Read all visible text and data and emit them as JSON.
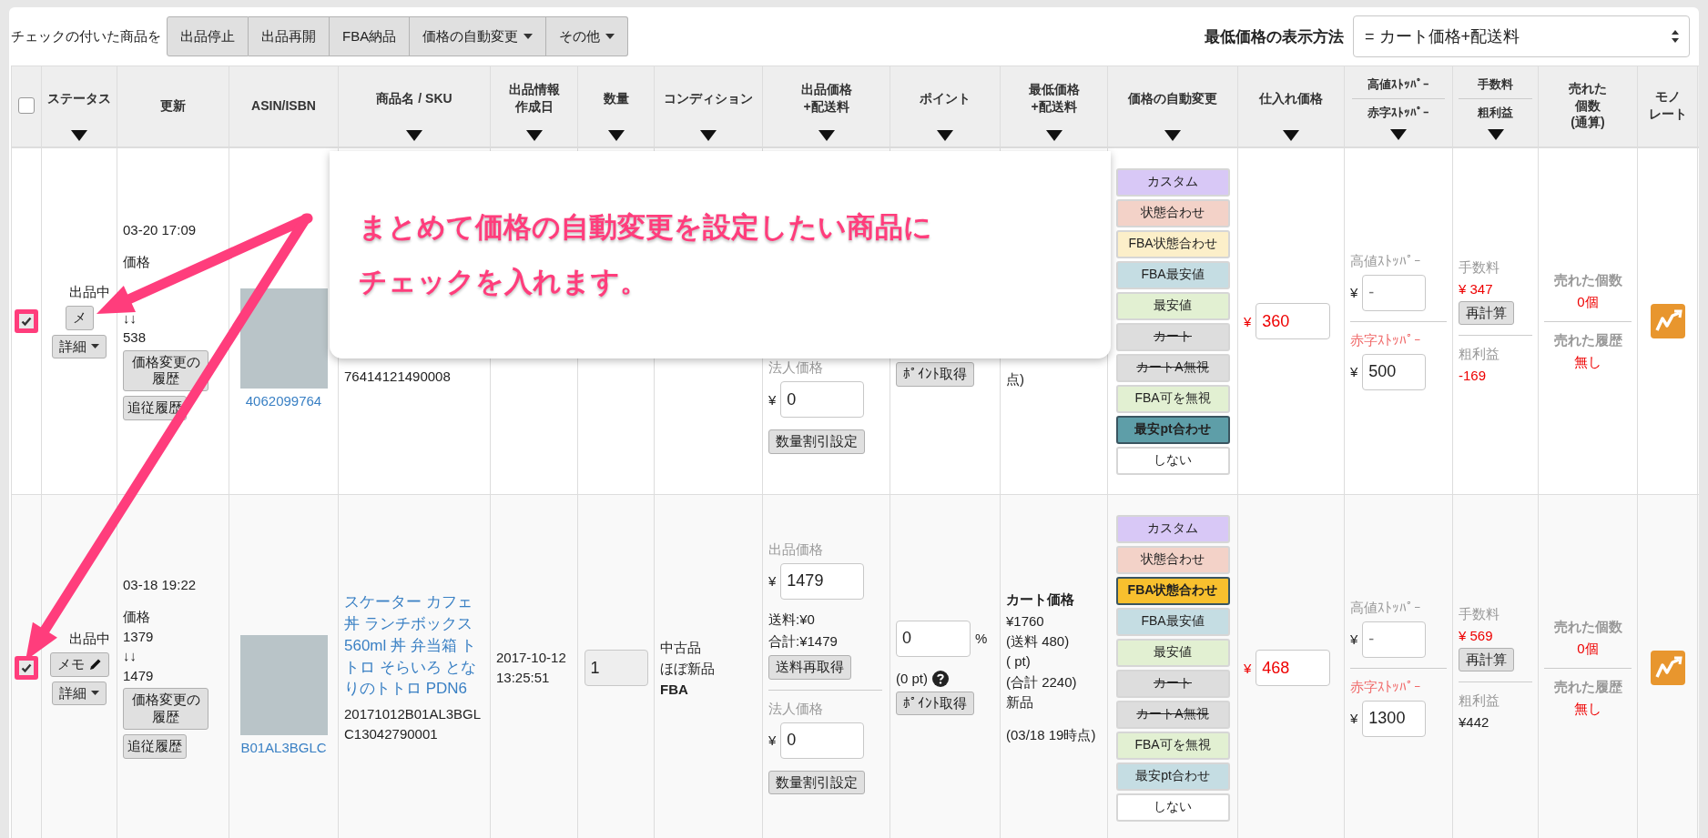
{
  "toolbar": {
    "label": "チェックの付いた商品を",
    "buttons": [
      {
        "label": "出品停止",
        "dropdown": false
      },
      {
        "label": "出品再開",
        "dropdown": false
      },
      {
        "label": "FBA納品",
        "dropdown": false
      },
      {
        "label": "価格の自動変更",
        "dropdown": true
      },
      {
        "label": "その他",
        "dropdown": true
      }
    ]
  },
  "display_method": {
    "label": "最低価格の表示方法",
    "value": "= カート価格+配送料"
  },
  "table": {
    "header_checkbox": {
      "checked": false
    },
    "columns": [
      {
        "lines": [
          "ステータス"
        ],
        "sortable": true
      },
      {
        "lines": [
          "更新"
        ],
        "sortable": false
      },
      {
        "lines": [
          "ASIN/ISBN"
        ],
        "sortable": false
      },
      {
        "lines": [
          "商品名 / SKU"
        ],
        "sortable": true
      },
      {
        "lines": [
          "出品情報",
          "作成日"
        ],
        "sortable": true
      },
      {
        "lines": [
          "数量"
        ],
        "sortable": true
      },
      {
        "lines": [
          "コンディション"
        ],
        "sortable": true
      },
      {
        "lines": [
          "出品価格",
          "+配送料"
        ],
        "sortable": true
      },
      {
        "lines": [
          "ポイント"
        ],
        "sortable": true
      },
      {
        "lines": [
          "最低価格",
          "+配送料"
        ],
        "sortable": true
      },
      {
        "lines": [
          "価格の自動変更"
        ],
        "sortable": true
      },
      {
        "lines": [
          "仕入れ価格"
        ],
        "sortable": true
      },
      {
        "lines": [
          "高値ｽﾄｯﾊﾟｰ"
        ],
        "second": "赤字ｽﾄｯﾊﾟｰ",
        "sortable": true
      },
      {
        "lines": [
          "手数料"
        ],
        "second": "粗利益",
        "sortable": true
      },
      {
        "lines": [
          "売れた",
          "個数",
          "(通算)"
        ],
        "sortable": false
      },
      {
        "lines": [
          "モノ",
          "レート"
        ],
        "sortable": false
      }
    ],
    "rows": [
      {
        "checked": true,
        "highlighted": true,
        "status": "出品中",
        "memo": {
          "label": "メ",
          "pencil": false
        },
        "detail": "詳細",
        "updated": "03-20 17:09",
        "price_history": [
          "価格",
          "↓↓",
          "538"
        ],
        "history_buttons": [
          "価格変更の履歴",
          "追従履歴"
        ],
        "asin": "4062099764",
        "sku": "76414121490008",
        "listing": {
          "corporate_label": "法人価格",
          "corporate_currency": "¥",
          "corporate_value": "0",
          "discount_button": "数量割引設定"
        },
        "points": {
          "button": "ﾎﾟｲﾝﾄ取得"
        },
        "lowest": {
          "lines": [
            "点)"
          ]
        },
        "auto_price": [
          {
            "label": "カスタム",
            "color": "#d8c8f6",
            "selected": false,
            "strike": false
          },
          {
            "label": "状態合わせ",
            "color": "#f3d2c8",
            "selected": false,
            "strike": false
          },
          {
            "label": "FBA状態合わせ",
            "color": "#fcefc9",
            "selected": false,
            "strike": false
          },
          {
            "label": "FBA最安値",
            "color": "#c5dde3",
            "selected": false,
            "strike": false
          },
          {
            "label": "最安値",
            "color": "#e2f0d2",
            "selected": false,
            "strike": false
          },
          {
            "label": "カート",
            "color": "#dddddd",
            "selected": false,
            "strike": true
          },
          {
            "label": "カートA無視",
            "color": "#dddddd",
            "selected": false,
            "strike": true
          },
          {
            "label": "FBA可を無視",
            "color": "#e2f0d2",
            "selected": false,
            "strike": false
          },
          {
            "label": "最安pt合わせ",
            "color": "#5e9ea8",
            "selected": true,
            "strike": false
          },
          {
            "label": "しない",
            "color": "#ffffff",
            "selected": false,
            "strike": false
          }
        ],
        "purchase": {
          "currency": "¥",
          "value": "360"
        },
        "stoppers": {
          "high_label": "高値ｽﾄｯﾊﾟｰ",
          "high_currency": "¥",
          "high_placeholder": "-",
          "low_label": "赤字ｽﾄｯﾊﾟｰ",
          "low_currency": "¥",
          "low_value": "500"
        },
        "fees": {
          "fee_label": "手数料",
          "fee": "¥ 347",
          "recalc_button": "再計算",
          "profit_label": "粗利益",
          "profit": "-169",
          "loss": true
        },
        "sold": {
          "count_label": "売れた個数",
          "count": "0個",
          "history_label": "売れた履歴",
          "history": "無し"
        }
      },
      {
        "checked": true,
        "highlighted": true,
        "status": "出品中",
        "memo": {
          "label": "メモ",
          "pencil": true
        },
        "detail": "詳細",
        "updated": "03-18 19:22",
        "price_history": [
          "価格",
          "1379",
          "↓↓",
          "1479"
        ],
        "history_buttons": [
          "価格変更の履歴",
          "追従履歴"
        ],
        "asin": "B01AL3BGLC",
        "name": "スケーター カフェ丼 ランチボックス 560ml 丼 弁当箱 トトロ そらいろ となりのトトロ PDN6",
        "sku": "20171012B01AL3BGLC13042790001",
        "created": "2017-10-12 13:25:51",
        "quantity": "1",
        "condition": {
          "lines": [
            "中古品",
            "ほぼ新品"
          ],
          "channel": "FBA"
        },
        "listing": {
          "price_label": "出品価格",
          "price_currency": "¥",
          "price_value": "1479",
          "shipping": "送料:¥0",
          "total": "合計:¥1479",
          "refetch_button": "送料再取得",
          "corporate_label": "法人価格",
          "corporate_currency": "¥",
          "corporate_value": "0",
          "discount_button": "数量割引設定"
        },
        "points": {
          "value": "0",
          "unit": "%",
          "pt": "(0 pt)",
          "help": true,
          "button": "ﾎﾟｲﾝﾄ取得"
        },
        "lowest": {
          "title": "カート価格",
          "lines": [
            "¥1760",
            "(送料 480)",
            "( pt)",
            "(合計 2240)",
            "新品"
          ],
          "note": "(03/18 19時点)"
        },
        "auto_price": [
          {
            "label": "カスタム",
            "color": "#d8c8f6",
            "selected": false,
            "strike": false
          },
          {
            "label": "状態合わせ",
            "color": "#f3d2c8",
            "selected": false,
            "strike": false
          },
          {
            "label": "FBA状態合わせ",
            "color": "#f8c02e",
            "selected": true,
            "strike": false
          },
          {
            "label": "FBA最安値",
            "color": "#c5dde3",
            "selected": false,
            "strike": false
          },
          {
            "label": "最安値",
            "color": "#e2f0d2",
            "selected": false,
            "strike": false
          },
          {
            "label": "カート",
            "color": "#dddddd",
            "selected": false,
            "strike": true
          },
          {
            "label": "カートA無視",
            "color": "#dddddd",
            "selected": false,
            "strike": true
          },
          {
            "label": "FBA可を無視",
            "color": "#e2f0d2",
            "selected": false,
            "strike": false
          },
          {
            "label": "最安pt合わせ",
            "color": "#c5dde3",
            "selected": false,
            "strike": false
          },
          {
            "label": "しない",
            "color": "#ffffff",
            "selected": false,
            "strike": false
          }
        ],
        "purchase": {
          "currency": "¥",
          "value": "468"
        },
        "stoppers": {
          "high_label": "高値ｽﾄｯﾊﾟｰ",
          "high_currency": "¥",
          "high_placeholder": "-",
          "low_label": "赤字ｽﾄｯﾊﾟｰ",
          "low_currency": "¥",
          "low_value": "1300"
        },
        "fees": {
          "fee_label": "手数料",
          "fee": "¥ 569",
          "recalc_button": "再計算",
          "profit_label": "粗利益",
          "profit": "¥442",
          "loss": false
        },
        "sold": {
          "count_label": "売れた個数",
          "count": "0個",
          "history_label": "売れた履歴",
          "history": "無し"
        }
      }
    ]
  },
  "annotation": {
    "lines": [
      "まとめて価格の自動変更を設定したい商品に",
      "チェックを入れます。"
    ]
  }
}
